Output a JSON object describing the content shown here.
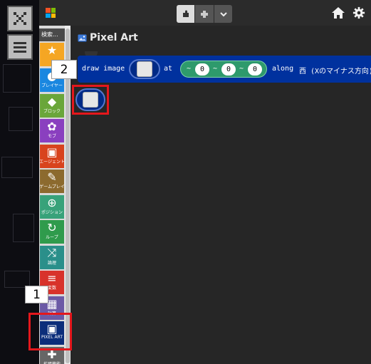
{
  "topbar": {
    "view_blocks": "blocks-view",
    "view_code": "code-view",
    "ms_colors": [
      "#f35325",
      "#81bc06",
      "#05a6f0",
      "#ffba08"
    ]
  },
  "categories": {
    "search_placeholder": "検索...",
    "items": [
      {
        "label": "",
        "color": "#f5a623",
        "icon": "star-icon"
      },
      {
        "label": "プレイヤー",
        "color": "#1a87e0",
        "icon": "player-icon"
      },
      {
        "label": "ブロック",
        "color": "#6aa63a",
        "icon": "cube-icon"
      },
      {
        "label": "モブ",
        "color": "#8a3fbf",
        "icon": "paw-icon"
      },
      {
        "label": "エージェント",
        "color": "#d8431d",
        "icon": "agent-icon"
      },
      {
        "label": "ゲームプレイ",
        "color": "#8c6a2e",
        "icon": "wrench-icon"
      },
      {
        "label": "ポジション",
        "color": "#38a27a",
        "icon": "crosshair-icon"
      },
      {
        "label": "ループ",
        "color": "#2f9b4c",
        "icon": "loop-icon"
      },
      {
        "label": "論理",
        "color": "#2a8f8a",
        "icon": "shuffle-icon"
      },
      {
        "label": "変数",
        "color": "#d8322b",
        "icon": "list-icon"
      },
      {
        "label": "計算",
        "color": "#6c5aa6",
        "icon": "calculator-icon"
      },
      {
        "label": "PIXEL ART",
        "color": "#0b2d7a",
        "icon": "image-icon"
      },
      {
        "label": "拡張機能",
        "color": "#666666",
        "icon": "plus-icon"
      }
    ]
  },
  "workspace": {
    "title": "Pixel Art",
    "block": {
      "draw_label": "draw image",
      "at_label": "at",
      "tilde": "~",
      "x": "0",
      "y": "0",
      "z": "0",
      "along_label": "along",
      "direction": "西 (Xのマイナス方向)"
    }
  },
  "annotations": {
    "tag1": "1",
    "tag2": "2"
  }
}
